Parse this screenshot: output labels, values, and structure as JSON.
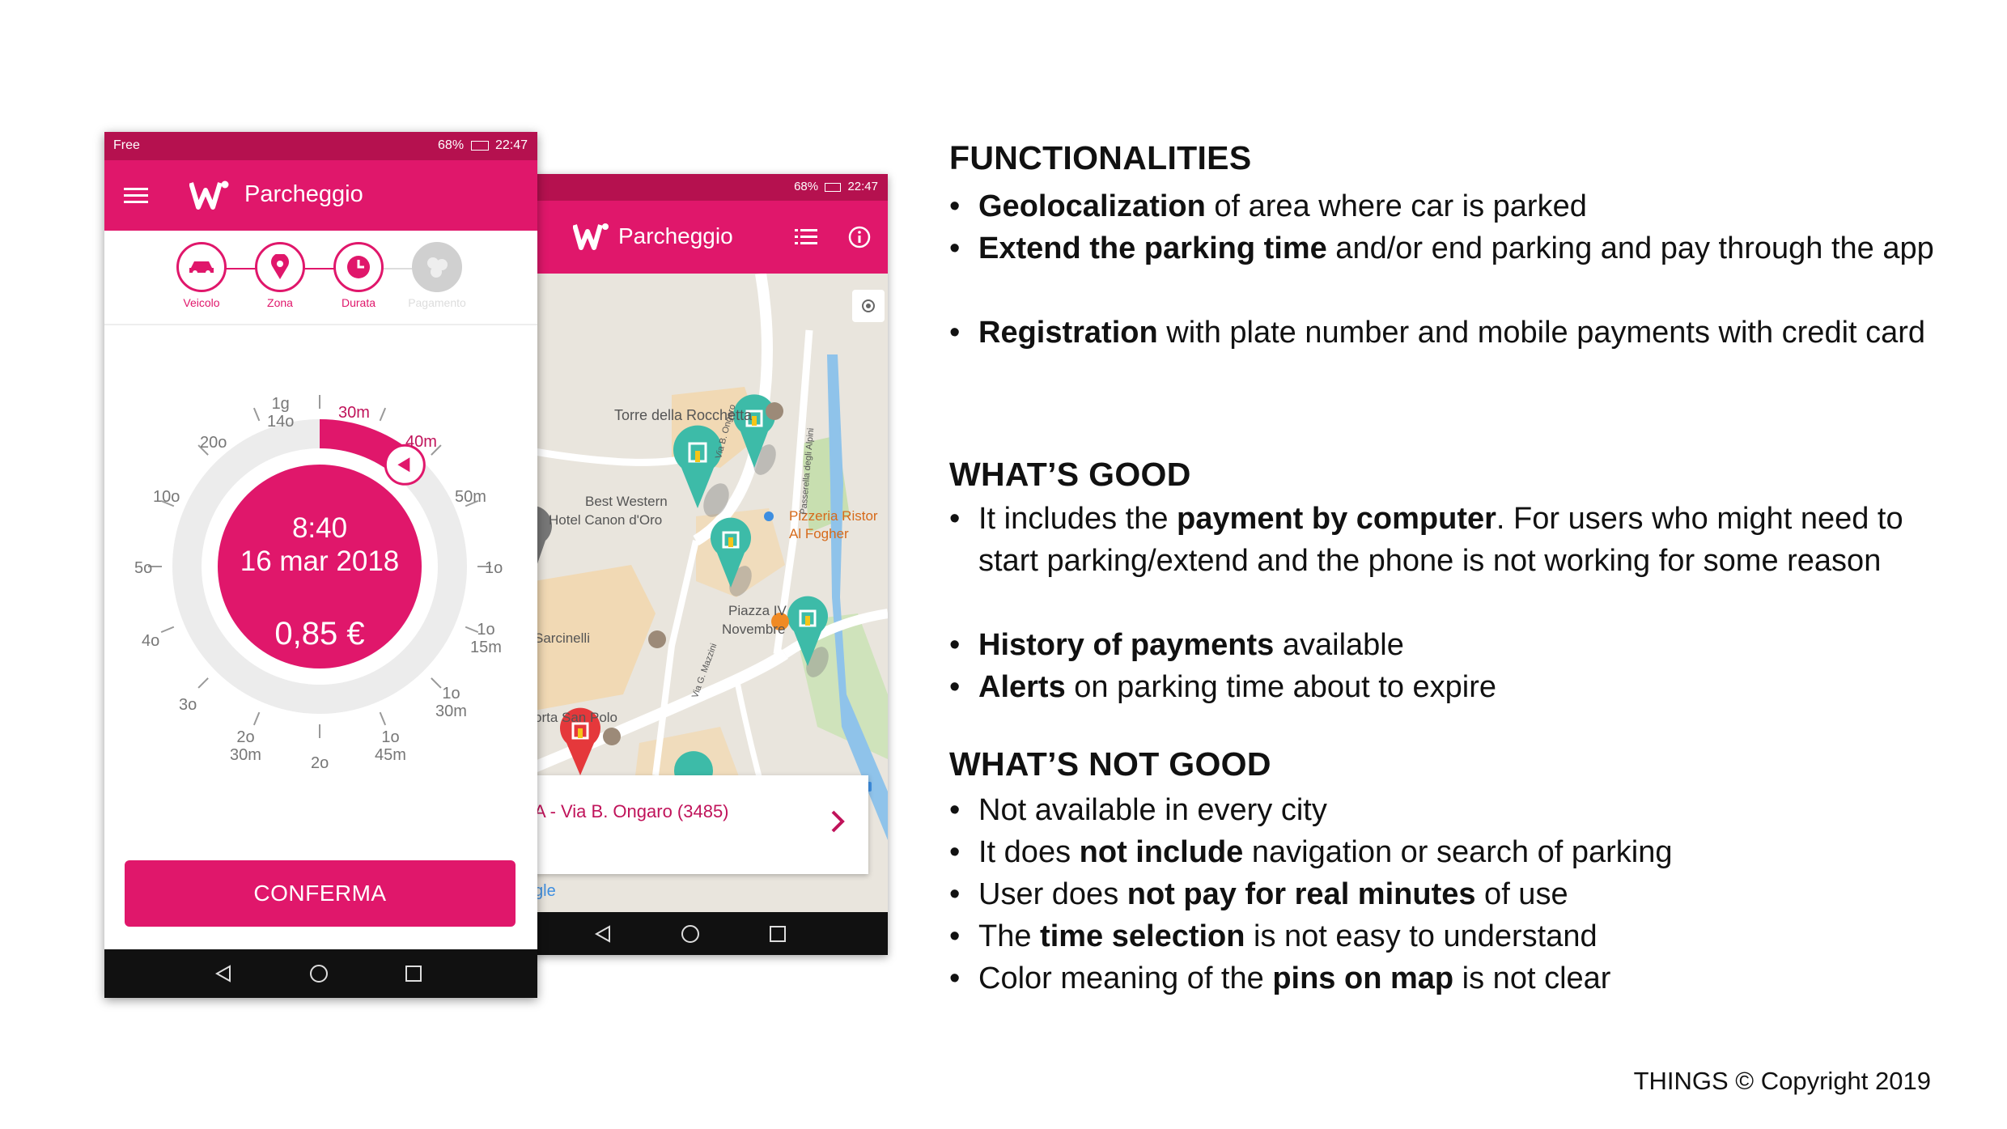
{
  "phone_back": {
    "status_time": "22:47",
    "status_battery": "68%",
    "app_title": "Parcheggio",
    "map_labels": [
      "Torre della Rocchetta",
      "Best Western",
      "Hotel Canon d'Oro",
      "Pizzeria Ristor",
      "Al Fogher",
      "Piazza IV",
      "Novembre",
      "Sarcinelli",
      "orta San Polo",
      "Passerella degli Alpini",
      "Via B. Ongaro",
      "Via G. Mazzini"
    ],
    "card_text": "A - Via B. Ongaro (3485)",
    "google_text": "gle"
  },
  "phone_front": {
    "status_carrier": "Free",
    "status_time": "22:47",
    "status_battery": "68%",
    "app_title": "Parcheggio",
    "steps": [
      {
        "label": "Veicolo",
        "icon": "car-icon",
        "state": "done"
      },
      {
        "label": "Zona",
        "icon": "location-pin-icon",
        "state": "done"
      },
      {
        "label": "Durata",
        "icon": "clock-icon",
        "state": "active"
      },
      {
        "label": "Pagamento",
        "icon": "coins-icon",
        "state": "disabled"
      }
    ],
    "dial": {
      "time": "8:40",
      "date": "16 mar 2018",
      "price": "0,85 €",
      "selected_fraction": 0.111,
      "labels": {
        "l1g14o": [
          "1g",
          "14o"
        ],
        "l30m": "30m",
        "l40m": "40m",
        "l50m": "50m",
        "l1o": "1o",
        "l1o15m": [
          "1o",
          "15m"
        ],
        "l1o30m": [
          "1o",
          "30m"
        ],
        "l1o45m": [
          "1o",
          "45m"
        ],
        "l2o": "2o",
        "l2o30m": [
          "2o",
          "30m"
        ],
        "l3o": "3o",
        "l4o": "4o",
        "l5o": "5o",
        "l10o": "10o",
        "l20o": "20o"
      }
    },
    "confirm_label": "CONFERMA"
  },
  "sections": {
    "functionalities": {
      "title": "FUNCTIONALITIES",
      "items": [
        {
          "bold": "Geolocalization",
          "rest": " of area where car is parked"
        },
        {
          "bold": "Extend the parking time",
          "rest": " and/or end parking and pay through the app"
        },
        {
          "bold": "Registration",
          "rest": " with plate number and mobile payments with credit card"
        }
      ]
    },
    "good": {
      "title": "WHAT’S GOOD",
      "items": [
        {
          "pre": "It includes the ",
          "bold": "payment by computer",
          "rest": ". For users who might need to start parking/extend and the phone is not working for some reason"
        },
        {
          "pre": "",
          "bold": "History of payments",
          "rest": " available"
        },
        {
          "pre": "",
          "bold": "Alerts",
          "rest": " on parking time about to expire"
        }
      ]
    },
    "not_good": {
      "title": "WHAT’S NOT GOOD",
      "items": [
        {
          "pre": "Not available in every city",
          "bold": "",
          "rest": ""
        },
        {
          "pre": "It does ",
          "bold": "not include",
          "rest": " navigation or search of parking"
        },
        {
          "pre": "User does ",
          "bold": "not pay for real minutes",
          "rest": " of use"
        },
        {
          "pre": "The ",
          "bold": "time selection",
          "rest": " is not easy to understand"
        },
        {
          "pre": "Color meaning of the ",
          "bold": "pins on map",
          "rest": " is not clear"
        }
      ]
    }
  },
  "copyright": "THINGS © Copyright 2019",
  "colors": {
    "brand": "#e0176b",
    "brand_dark": "#b5114f",
    "pin_teal": "#3dbba8",
    "pin_red": "#e5383b"
  }
}
